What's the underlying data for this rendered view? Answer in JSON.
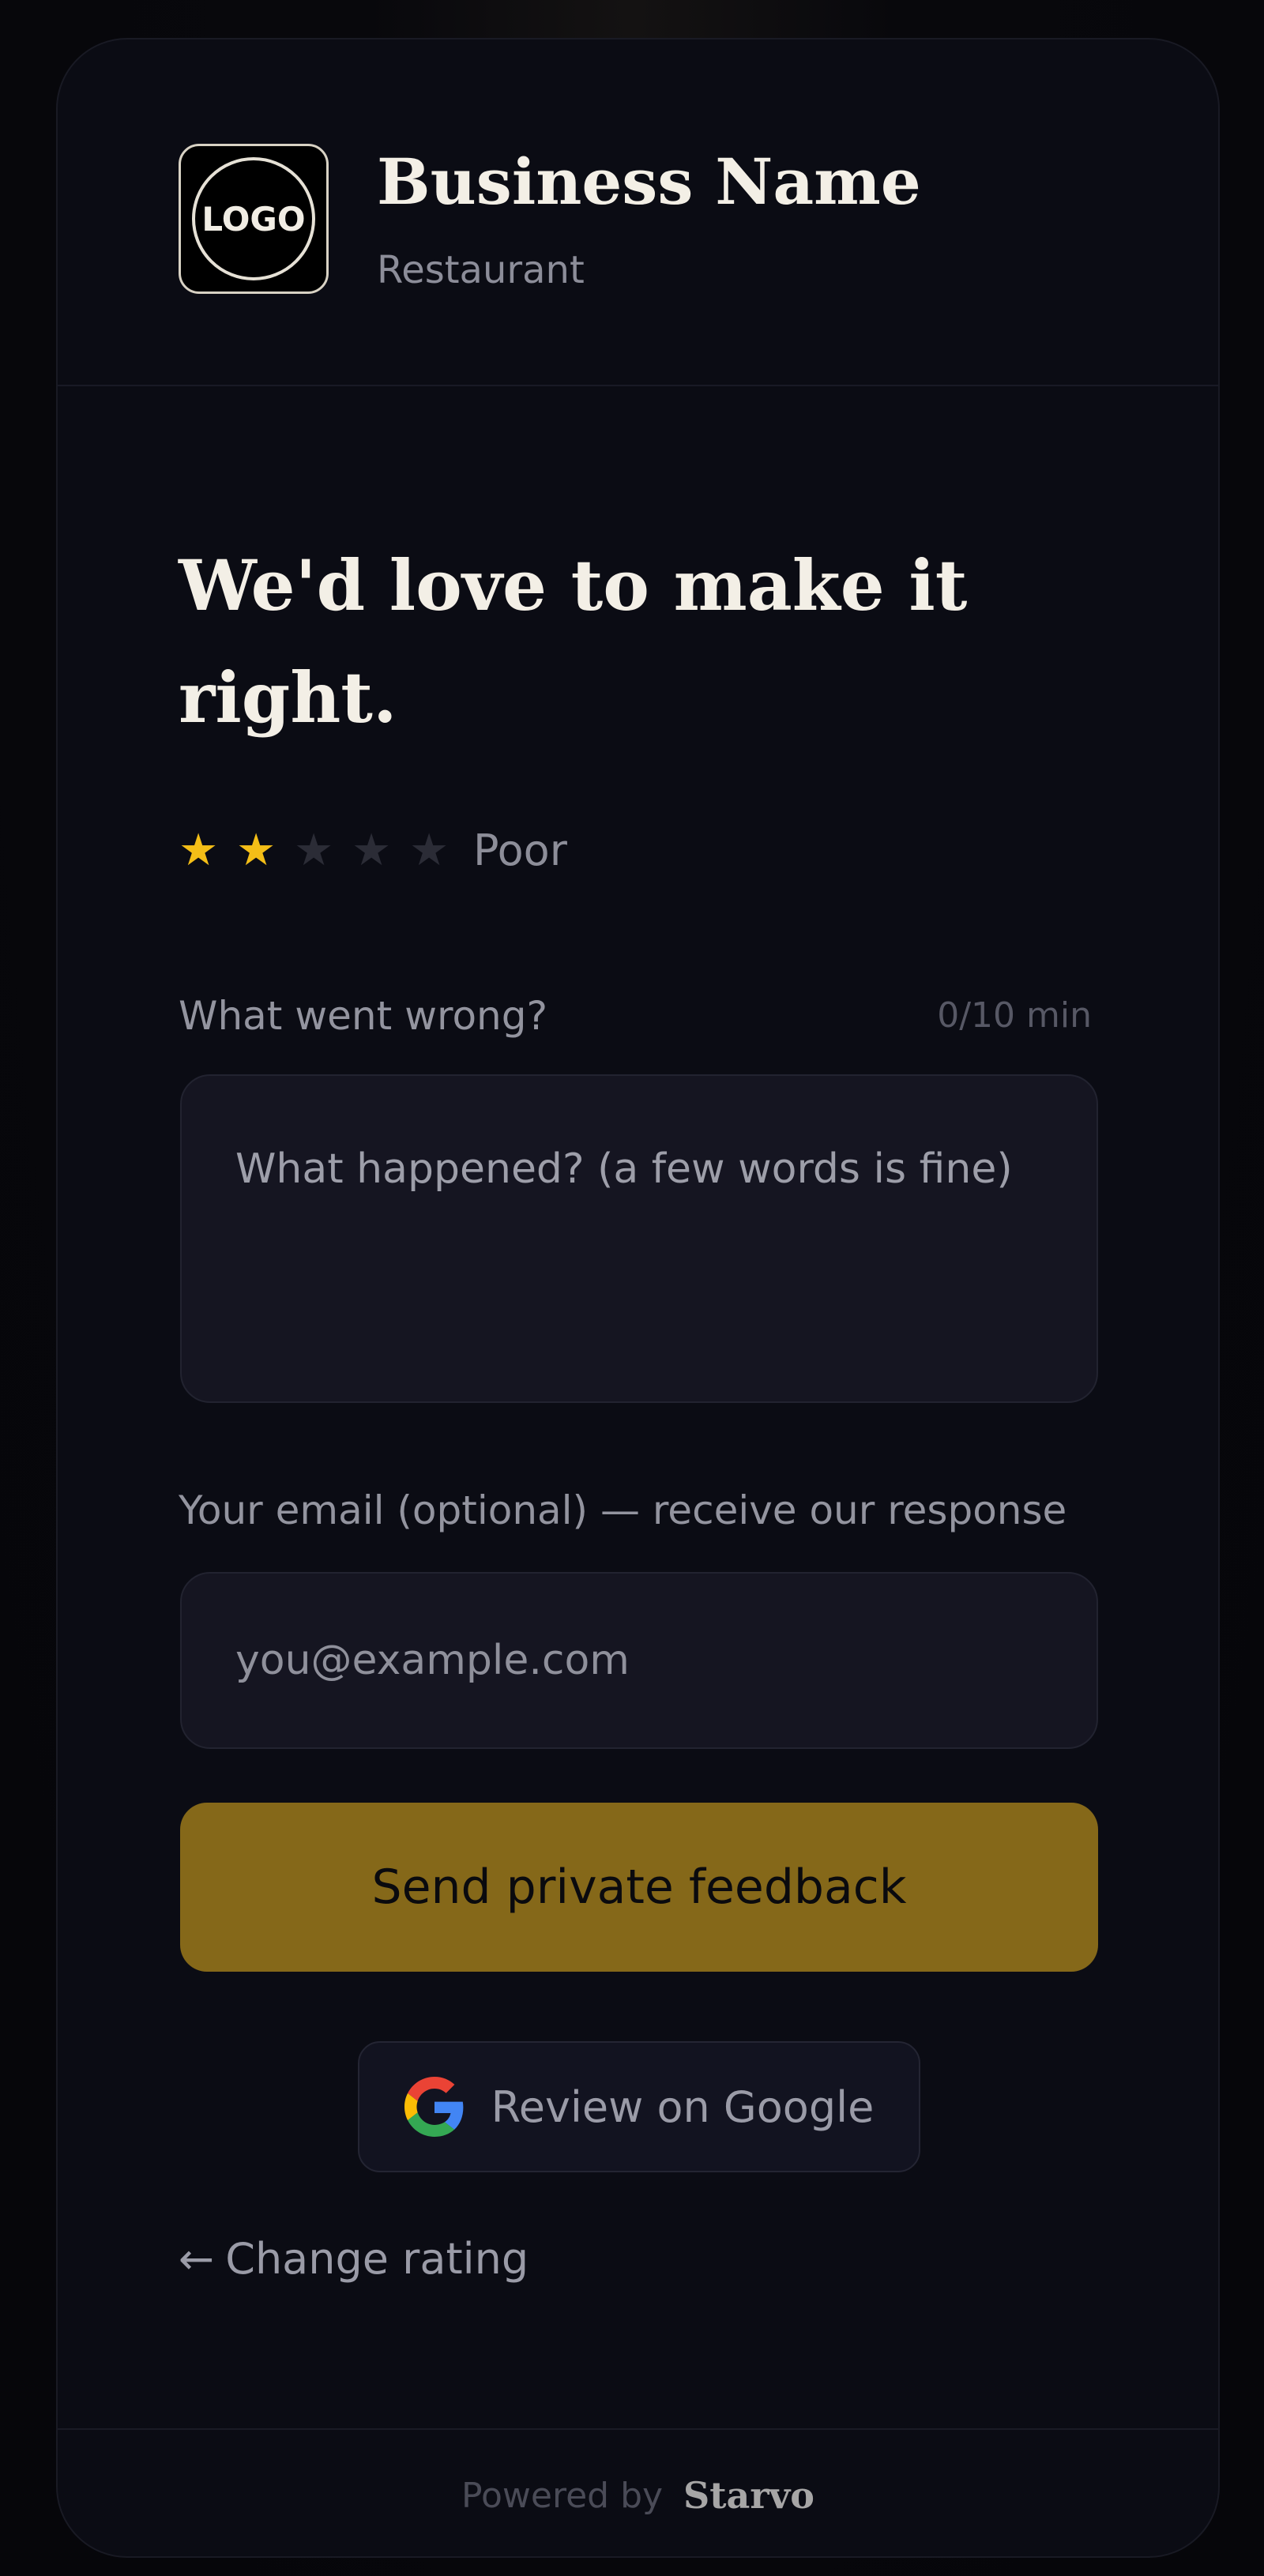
{
  "header": {
    "logo_text": "LOGO",
    "business_name": "Business Name",
    "business_type": "Restaurant"
  },
  "main": {
    "headline": "We'd love to make it right.",
    "rating": {
      "value": 2,
      "max": 5,
      "label": "Poor",
      "star_glyph": "★",
      "active_color": "#f4be17",
      "inactive_color": "#2b2c36"
    },
    "feedback": {
      "label": "What went wrong?",
      "counter": "0/10 min",
      "placeholder": "What happened? (a few words is fine)",
      "value": ""
    },
    "email": {
      "label": "Your email (optional) — receive our response",
      "placeholder": "you@example.com",
      "value": ""
    },
    "send_button": {
      "label": "Send private feedback",
      "color": "#856819"
    },
    "google_button": {
      "icon": "google-g-icon",
      "label": "Review on Google"
    },
    "change_rating": {
      "arrow": "←",
      "label": "Change rating"
    }
  },
  "footer": {
    "powered_by": "Powered by",
    "brand": "Starvo"
  }
}
